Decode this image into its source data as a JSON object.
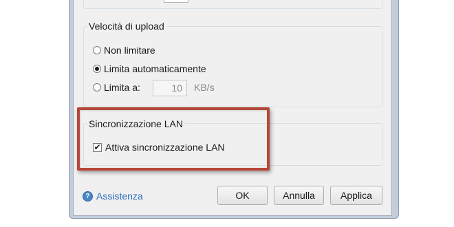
{
  "upload_speed": {
    "legend": "Velocità di upload",
    "options": [
      {
        "label": "Non limitare",
        "selected": false
      },
      {
        "label": "Limita automaticamente",
        "selected": true
      },
      {
        "label": "Limita a:",
        "selected": false
      }
    ],
    "limit_value": "10",
    "limit_unit": "KB/s"
  },
  "lan_sync": {
    "legend": "Sincronizzazione LAN",
    "checkbox_label": "Attiva sincronizzazione LAN",
    "checked": true
  },
  "footer": {
    "help_label": "Assistenza",
    "ok_label": "OK",
    "cancel_label": "Annulla",
    "apply_label": "Applica"
  },
  "colors": {
    "highlight_border": "#b5473a",
    "link": "#2a6ebb"
  }
}
